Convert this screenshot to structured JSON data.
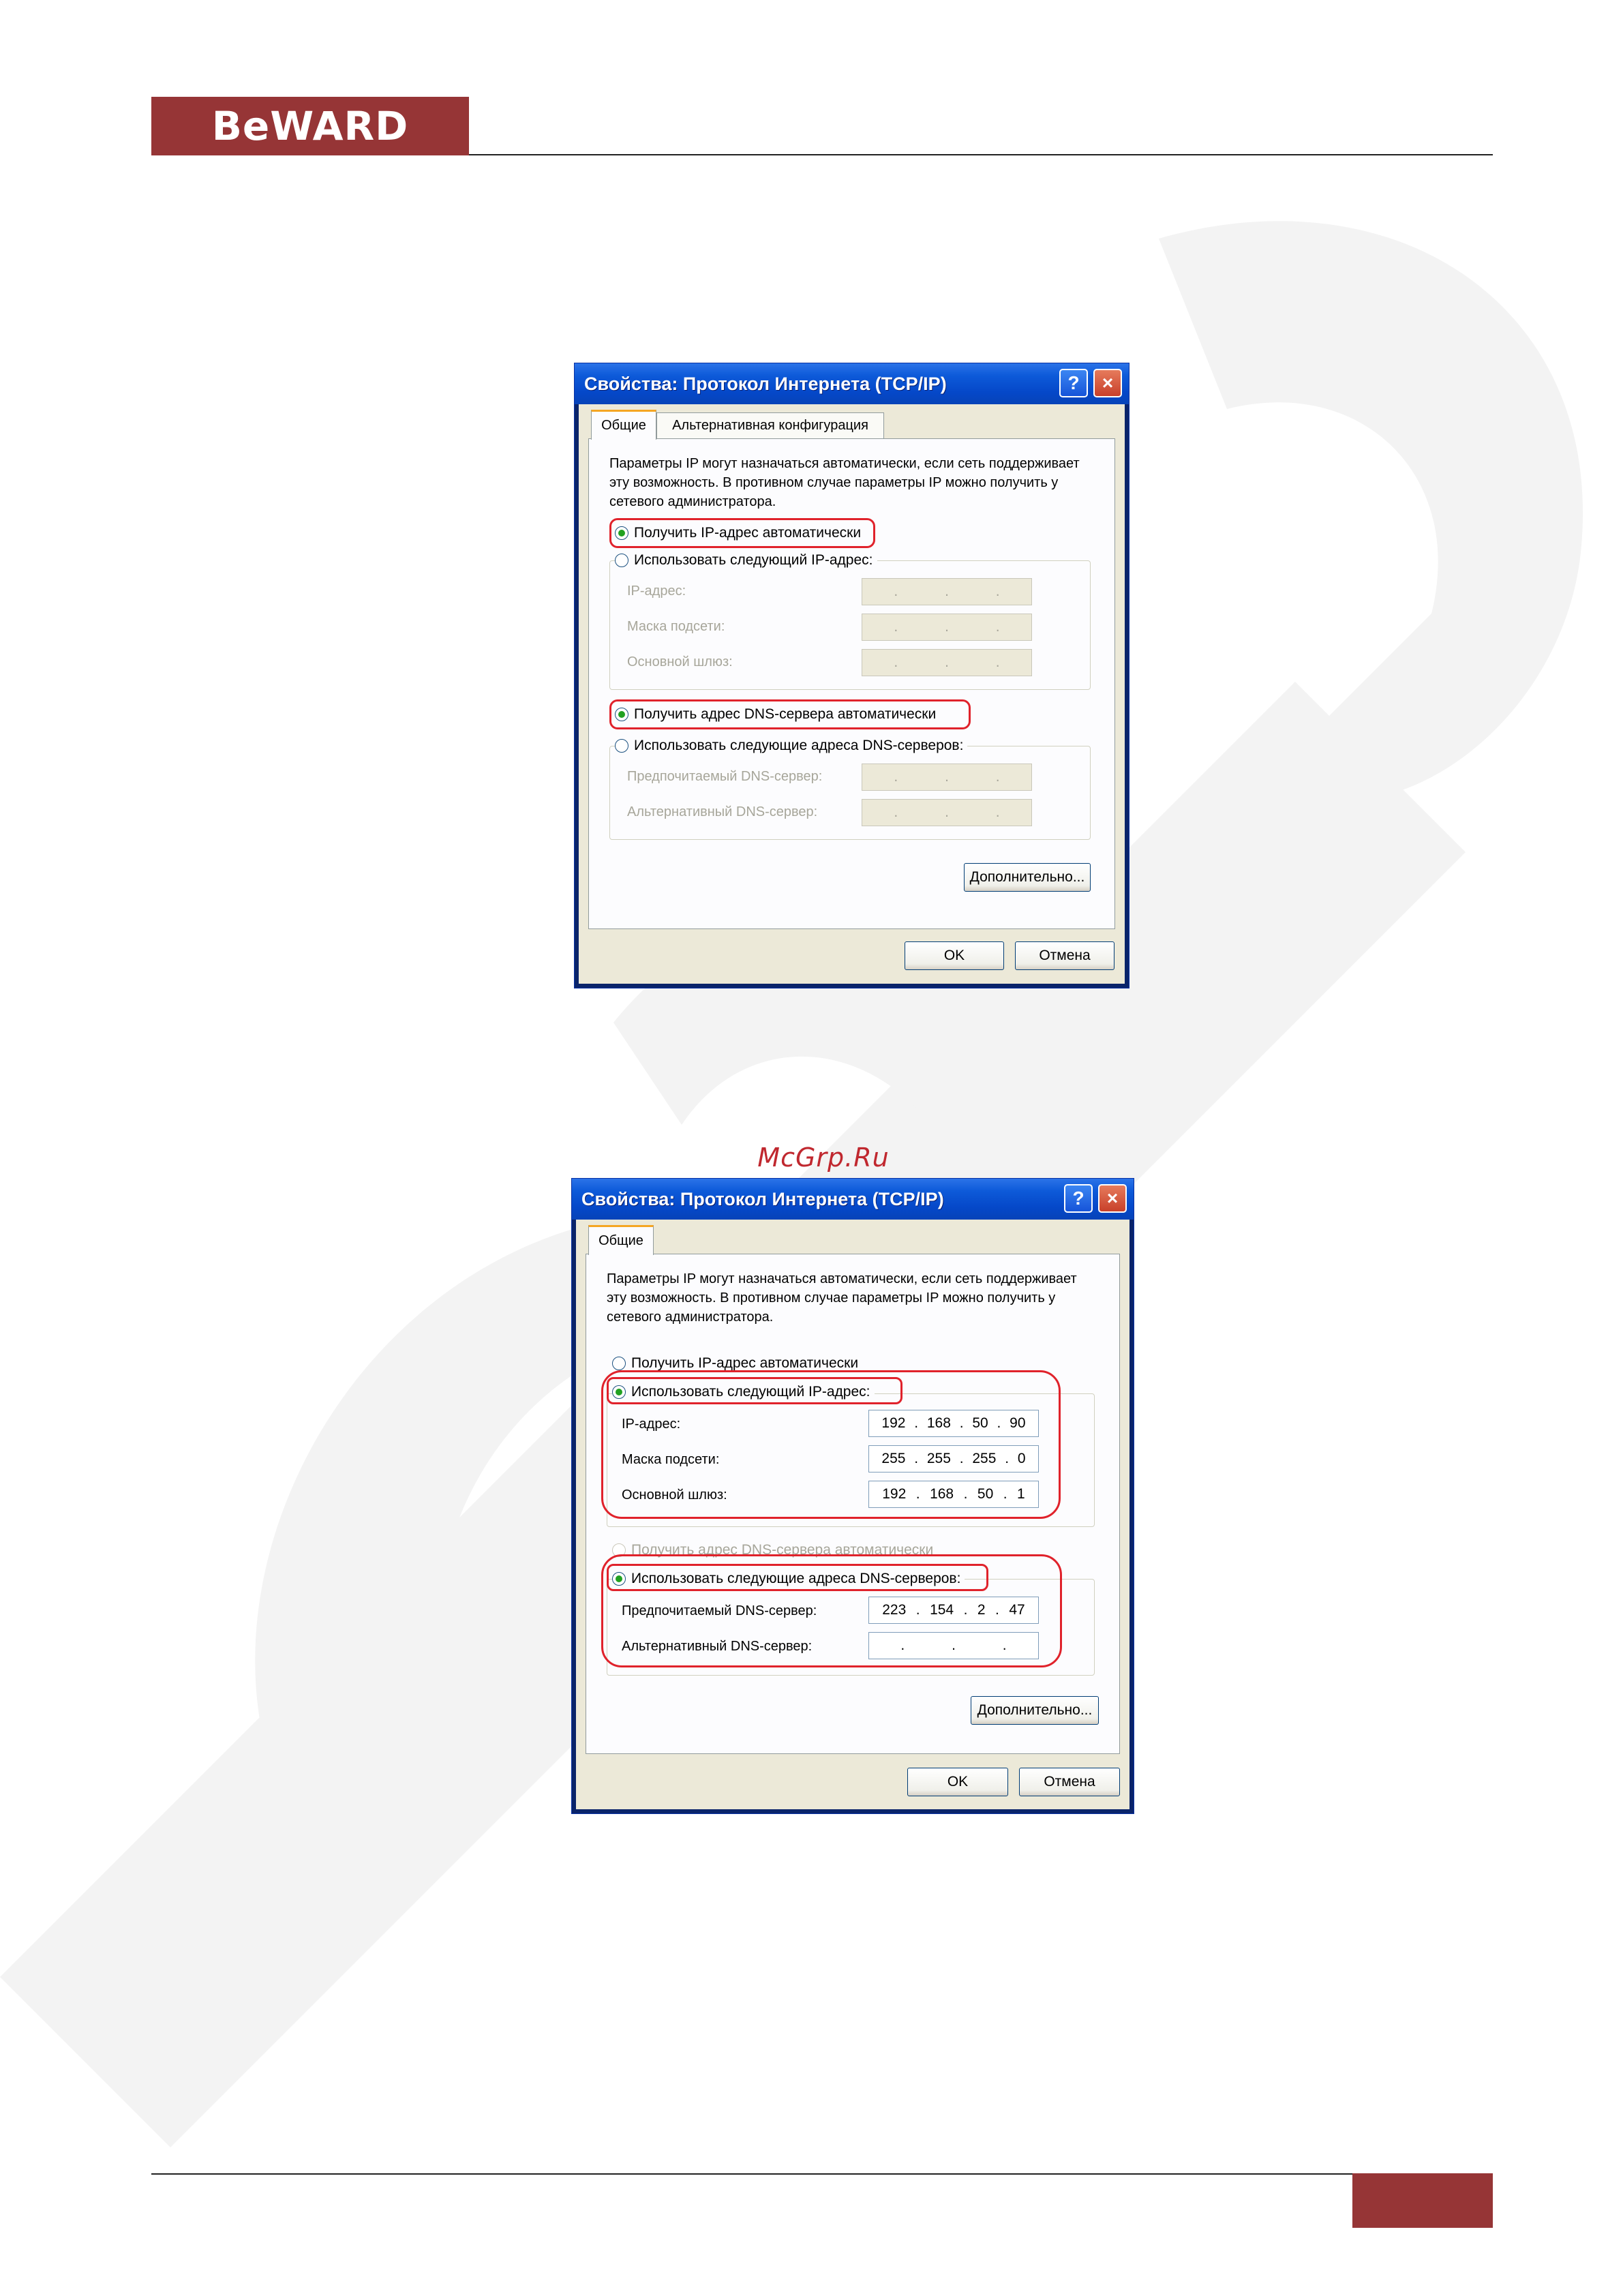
{
  "header": {
    "logo_text": "BeWARD"
  },
  "watermark": {
    "text": "BeWARD",
    "color": "#f2f2f2"
  },
  "site_mark": "McGrp.Ru",
  "colors": {
    "brand": "#963536",
    "title_bar": "#0548c9",
    "highlight": "#e0222b",
    "radio_dot": "#21a121"
  },
  "dialog1": {
    "title": "Свойства: Протокол Интернета (TCP/IP)",
    "help_icon": "?",
    "close_icon": "×",
    "tabs": [
      "Общие",
      "Альтернативная конфигурация"
    ],
    "description": "Параметры IP могут назначаться автоматически, если сеть поддерживает эту возможность. В противном случае параметры IP можно получить у сетевого администратора.",
    "opt_ip_auto": "Получить IP-адрес автоматически",
    "opt_ip_manual": "Использовать следующий IP-адрес:",
    "label_ip": "IP-адрес:",
    "label_mask": "Маска подсети:",
    "label_gateway": "Основной шлюз:",
    "opt_dns_auto": "Получить адрес DNS-сервера автоматически",
    "opt_dns_manual": "Использовать следующие адреса DNS-серверов:",
    "label_dns_pref": "Предпочитаемый DNS-сервер:",
    "label_dns_alt": "Альтернативный DNS-сервер:",
    "advanced_button": "Дополнительно...",
    "ok_button": "OK",
    "cancel_button": "Отмена"
  },
  "dialog2": {
    "title": "Свойства: Протокол Интернета (TCP/IP)",
    "help_icon": "?",
    "close_icon": "×",
    "tabs": [
      "Общие"
    ],
    "description": "Параметры IP могут назначаться автоматически, если сеть поддерживает эту возможность. В противном случае параметры IP можно получить у сетевого администратора.",
    "opt_ip_auto": "Получить IP-адрес автоматически",
    "opt_ip_manual": "Использовать следующий IP-адрес:",
    "label_ip": "IP-адрес:",
    "label_mask": "Маска подсети:",
    "label_gateway": "Основной шлюз:",
    "ip": [
      "192",
      "168",
      "50",
      "90"
    ],
    "mask": [
      "255",
      "255",
      "255",
      "0"
    ],
    "gateway": [
      "192",
      "168",
      "50",
      "1"
    ],
    "opt_dns_auto": "Получить адрес DNS-сервера автоматически",
    "opt_dns_manual": "Использовать следующие адреса DNS-серверов:",
    "label_dns_pref": "Предпочитаемый DNS-сервер:",
    "label_dns_alt": "Альтернативный DNS-сервер:",
    "dns_pref": [
      "223",
      "154",
      "2",
      "47"
    ],
    "advanced_button": "Дополнительно...",
    "ok_button": "OK",
    "cancel_button": "Отмена"
  }
}
